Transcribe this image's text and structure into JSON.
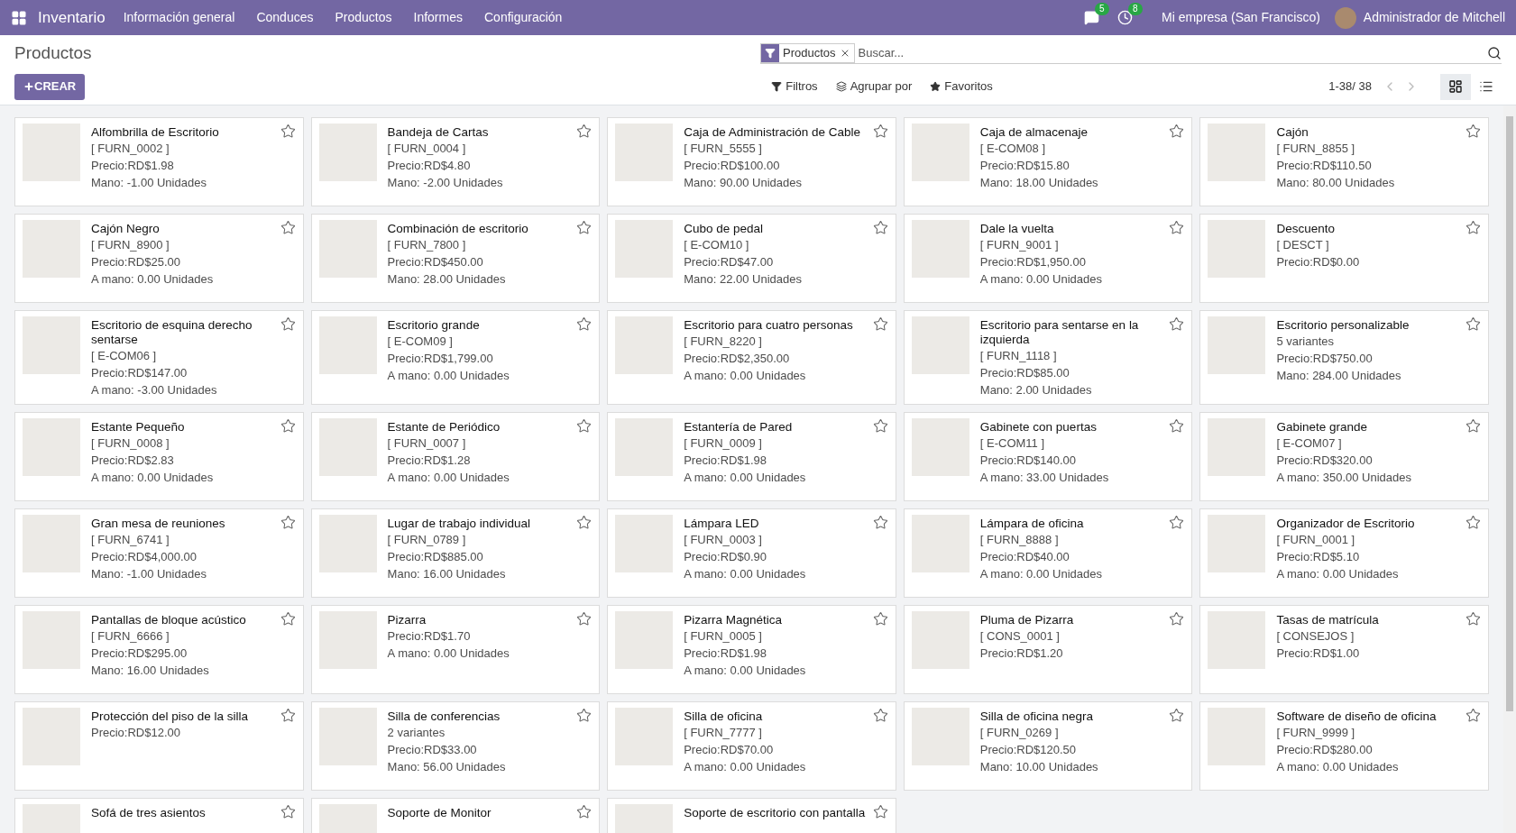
{
  "navbar": {
    "app_name": "Inventario",
    "menu": [
      "Información general",
      "Conduces",
      "Productos",
      "Informes",
      "Configuración"
    ],
    "messages_badge": "5",
    "activities_badge": "8",
    "company": "Mi empresa (San Francisco)",
    "user": "Administrador de Mitchell"
  },
  "control_panel": {
    "title": "Productos",
    "facet": "Productos",
    "search_placeholder": "Buscar...",
    "create_button": "CREAR",
    "filters": "Filtros",
    "group_by": "Agrupar por",
    "favorites": "Favoritos",
    "pager": "1-38/ 38",
    "views": [
      {
        "kind": "kanban",
        "selected": true
      },
      {
        "kind": "list",
        "selected": false
      }
    ]
  },
  "products": [
    {
      "name": "Alfombrilla de Escritorio",
      "code": "[ FURN_0002 ]",
      "price": "Precio:RD$1.98",
      "on_hand": "Mano: -1.00 Unidades"
    },
    {
      "name": "Bandeja de Cartas",
      "code": "[ FURN_0004 ]",
      "price": "Precio:RD$4.80",
      "on_hand": "Mano: -2.00 Unidades"
    },
    {
      "name": "Caja de Administración de Cable",
      "code": "[ FURN_5555 ]",
      "price": "Precio:RD$100.00",
      "on_hand": "Mano: 90.00 Unidades"
    },
    {
      "name": "Caja de almacenaje",
      "code": "[ E-COM08 ]",
      "price": "Precio:RD$15.80",
      "on_hand": "Mano: 18.00 Unidades"
    },
    {
      "name": "Cajón",
      "code": "[ FURN_8855 ]",
      "price": "Precio:RD$110.50",
      "on_hand": "Mano: 80.00 Unidades"
    },
    {
      "name": "Cajón Negro",
      "code": "[ FURN_8900 ]",
      "price": "Precio:RD$25.00",
      "on_hand": "A mano: 0.00 Unidades"
    },
    {
      "name": "Combinación de escritorio",
      "code": "[ FURN_7800 ]",
      "price": "Precio:RD$450.00",
      "on_hand": "Mano: 28.00 Unidades"
    },
    {
      "name": "Cubo de pedal",
      "code": "[ E-COM10 ]",
      "price": "Precio:RD$47.00",
      "on_hand": "Mano: 22.00 Unidades"
    },
    {
      "name": "Dale la vuelta",
      "code": "[ FURN_9001 ]",
      "price": "Precio:RD$1,950.00",
      "on_hand": "A mano: 0.00 Unidades"
    },
    {
      "name": "Descuento",
      "code": "[ DESCT ]",
      "price": "Precio:RD$0.00"
    },
    {
      "name": "Escritorio de esquina derecho sentarse",
      "code": "[ E-COM06 ]",
      "price": "Precio:RD$147.00",
      "on_hand": "A mano: -3.00 Unidades"
    },
    {
      "name": "Escritorio grande",
      "code": "[ E-COM09 ]",
      "price": "Precio:RD$1,799.00",
      "on_hand": "A mano: 0.00 Unidades"
    },
    {
      "name": "Escritorio para cuatro personas",
      "code": "[ FURN_8220 ]",
      "price": "Precio:RD$2,350.00",
      "on_hand": "A mano: 0.00 Unidades"
    },
    {
      "name": "Escritorio para sentarse en la izquierda",
      "code": "[ FURN_1118 ]",
      "price": "Precio:RD$85.00",
      "on_hand": "Mano: 2.00 Unidades"
    },
    {
      "name": "Escritorio personalizable",
      "code": "5 variantes",
      "price": "Precio:RD$750.00",
      "on_hand": "Mano: 284.00 Unidades"
    },
    {
      "name": "Estante Pequeño",
      "code": "[ FURN_0008 ]",
      "price": "Precio:RD$2.83",
      "on_hand": "A mano: 0.00 Unidades"
    },
    {
      "name": "Estante de Periódico",
      "code": "[ FURN_0007 ]",
      "price": "Precio:RD$1.28",
      "on_hand": "A mano: 0.00 Unidades"
    },
    {
      "name": "Estantería de Pared",
      "code": "[ FURN_0009 ]",
      "price": "Precio:RD$1.98",
      "on_hand": "A mano: 0.00 Unidades"
    },
    {
      "name": "Gabinete con puertas",
      "code": "[ E-COM11 ]",
      "price": "Precio:RD$140.00",
      "on_hand": "A mano: 33.00 Unidades"
    },
    {
      "name": "Gabinete grande",
      "code": "[ E-COM07 ]",
      "price": "Precio:RD$320.00",
      "on_hand": "A mano: 350.00 Unidades"
    },
    {
      "name": "Gran mesa de reuniones",
      "code": "[ FURN_6741 ]",
      "price": "Precio:RD$4,000.00",
      "on_hand": "Mano: -1.00 Unidades"
    },
    {
      "name": "Lugar de trabajo individual",
      "code": "[ FURN_0789 ]",
      "price": "Precio:RD$885.00",
      "on_hand": "Mano: 16.00 Unidades"
    },
    {
      "name": "Lámpara LED",
      "code": "[ FURN_0003 ]",
      "price": "Precio:RD$0.90",
      "on_hand": "A mano: 0.00 Unidades"
    },
    {
      "name": "Lámpara de oficina",
      "code": "[ FURN_8888 ]",
      "price": "Precio:RD$40.00",
      "on_hand": "A mano: 0.00 Unidades"
    },
    {
      "name": "Organizador de Escritorio",
      "code": "[ FURN_0001 ]",
      "price": "Precio:RD$5.10",
      "on_hand": "A mano: 0.00 Unidades"
    },
    {
      "name": "Pantallas de bloque acústico",
      "code": "[ FURN_6666 ]",
      "price": "Precio:RD$295.00",
      "on_hand": "Mano: 16.00 Unidades"
    },
    {
      "name": "Pizarra",
      "price": "Precio:RD$1.70",
      "on_hand": "A mano: 0.00 Unidades"
    },
    {
      "name": "Pizarra Magnética",
      "code": "[ FURN_0005 ]",
      "price": "Precio:RD$1.98",
      "on_hand": "A mano: 0.00 Unidades"
    },
    {
      "name": "Pluma de Pizarra",
      "code": "[ CONS_0001 ]",
      "price": "Precio:RD$1.20"
    },
    {
      "name": "Tasas de matrícula",
      "code": "[ CONSEJOS ]",
      "price": "Precio:RD$1.00"
    },
    {
      "name": "Protección del piso de la silla",
      "price": "Precio:RD$12.00"
    },
    {
      "name": "Silla de conferencias",
      "code": "2 variantes",
      "price": "Precio:RD$33.00",
      "on_hand": "Mano: 56.00 Unidades"
    },
    {
      "name": "Silla de oficina",
      "code": "[ FURN_7777 ]",
      "price": "Precio:RD$70.00",
      "on_hand": "A mano: 0.00 Unidades"
    },
    {
      "name": "Silla de oficina negra",
      "code": "[ FURN_0269 ]",
      "price": "Precio:RD$120.50",
      "on_hand": "Mano: 10.00 Unidades"
    },
    {
      "name": "Software de diseño de oficina",
      "code": "[ FURN_9999 ]",
      "price": "Precio:RD$280.00",
      "on_hand": "A mano: 0.00 Unidades"
    },
    {
      "name": "Sofá de tres asientos"
    },
    {
      "name": "Soporte de Monitor"
    },
    {
      "name": "Soporte de escritorio con pantalla"
    }
  ]
}
